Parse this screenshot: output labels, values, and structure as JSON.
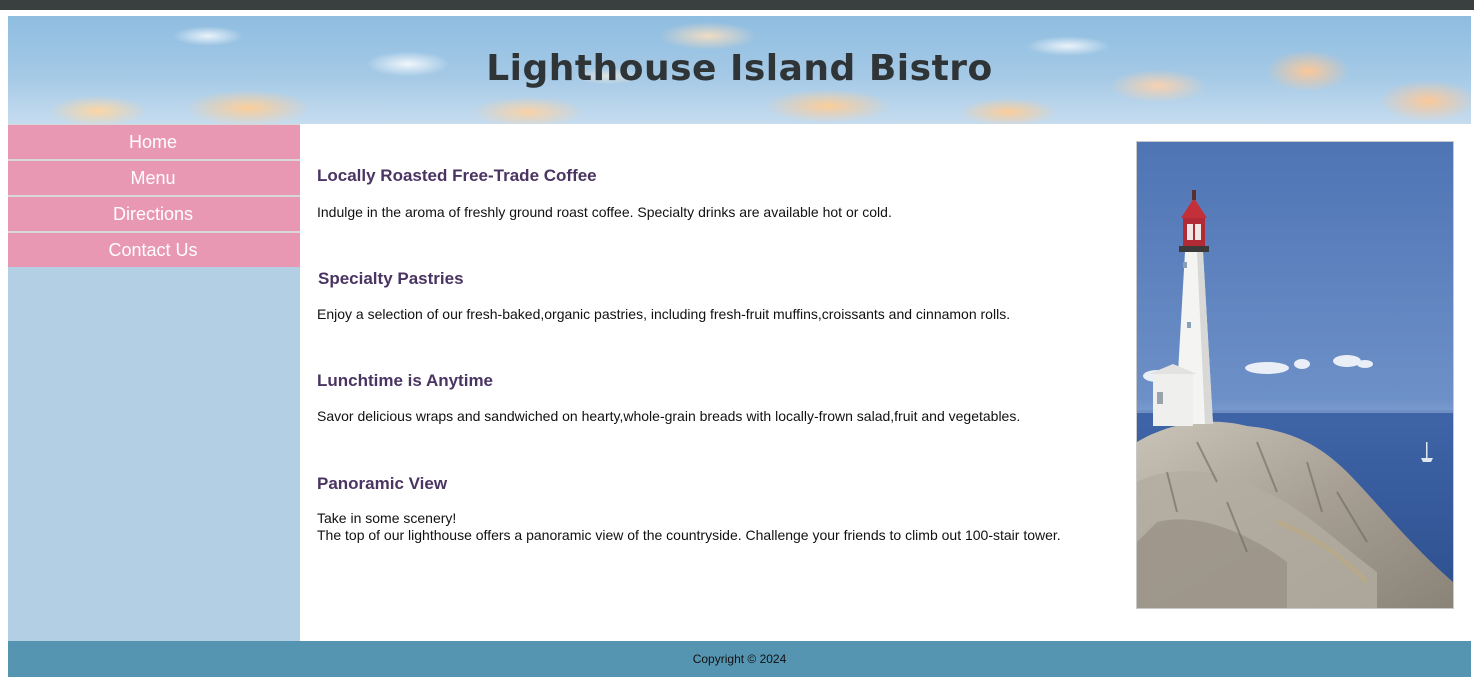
{
  "site": {
    "title": "Lighthouse Island Bistro"
  },
  "nav": {
    "items": [
      {
        "label": "Home"
      },
      {
        "label": "Menu"
      },
      {
        "label": "Directions"
      },
      {
        "label": "Contact Us"
      }
    ]
  },
  "sections": [
    {
      "heading": "Locally Roasted Free-Trade Coffee",
      "body": "Indulge in the aroma of freshly ground roast coffee. Specialty drinks are available hot or cold."
    },
    {
      "heading": "Specialty Pastries",
      "body": "Enjoy a selection of our fresh-baked,organic pastries, including fresh-fruit muffins,croissants and cinnamon rolls."
    },
    {
      "heading": "Lunchtime is Anytime",
      "body": "Savor delicious wraps and sandwiched on hearty,whole-grain breads with locally-frown salad,fruit and vegetables."
    },
    {
      "heading": "Panoramic View",
      "body_line1": "Take in some scenery!",
      "body_line2": "The top of our lighthouse offers a panoramic view of the countryside. Challenge your friends to climb out 100-stair tower."
    }
  ],
  "footer": {
    "copyright": "Copyright © 2024"
  },
  "colors": {
    "nav_bg": "#e998b3",
    "sidebar_bg": "#b3cfe4",
    "heading": "#4a3462",
    "footer_bg": "#5595b1"
  },
  "icons": {
    "hero_image": "lighthouse-photo",
    "banner_image": "sky-clouds-banner"
  }
}
